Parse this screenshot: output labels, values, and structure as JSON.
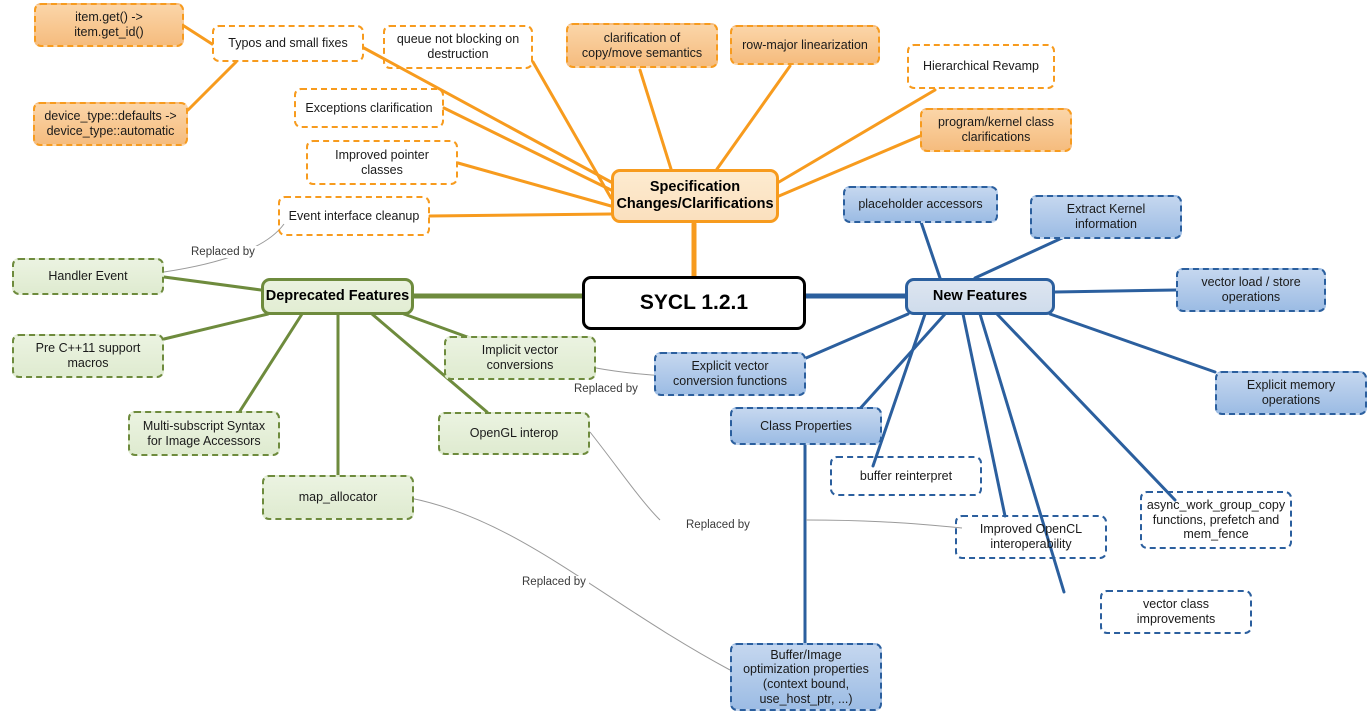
{
  "diagram": {
    "title": "SYCL 1.2.1 mind map",
    "colors": {
      "root_border": "#000000",
      "spec_branch": "#F79B1E",
      "deprecated_branch": "#6E8B3D",
      "new_features_branch": "#2B5F9E",
      "replaced_by_line": "#9a9a9a"
    },
    "root": {
      "label": "SYCL 1.2.1"
    },
    "branches": [
      {
        "id": "spec",
        "label": "Specification\nChanges/Clarifications",
        "color": "#F79B1E"
      },
      {
        "id": "deprecated",
        "label": "Deprecated Features",
        "color": "#6E8B3D"
      },
      {
        "id": "new",
        "label": "New Features",
        "color": "#2B5F9E"
      }
    ],
    "spec_nodes": [
      {
        "id": "typos",
        "label": "Typos and small fixes",
        "filled": false
      },
      {
        "id": "item_get",
        "label": "item.get() ->\nitem.get_id()",
        "filled": true
      },
      {
        "id": "device_type",
        "label": "device_type::defaults ->\ndevice_type::automatic",
        "filled": true
      },
      {
        "id": "queue_block",
        "label": "queue not blocking on\ndestruction",
        "filled": false
      },
      {
        "id": "copy_move",
        "label": "clarification of\ncopy/move semantics",
        "filled": true
      },
      {
        "id": "row_major",
        "label": "row-major linearization",
        "filled": true
      },
      {
        "id": "hierarchical",
        "label": "Hierarchical Revamp",
        "filled": false
      },
      {
        "id": "prog_kernel",
        "label": "program/kernel class\nclarifications",
        "filled": true
      },
      {
        "id": "exceptions",
        "label": "Exceptions clarification",
        "filled": false
      },
      {
        "id": "pointer",
        "label": "Improved pointer\nclasses",
        "filled": false
      },
      {
        "id": "event_iface",
        "label": "Event interface cleanup",
        "filled": false
      }
    ],
    "deprecated_nodes": [
      {
        "id": "handler_event",
        "label": "Handler Event",
        "filled": true
      },
      {
        "id": "pre_cxx11",
        "label": "Pre C++11 support\nmacros",
        "filled": true
      },
      {
        "id": "multi_sub",
        "label": "Multi-subscript Syntax\nfor Image Accessors",
        "filled": true
      },
      {
        "id": "map_allocator",
        "label": "map_allocator",
        "filled": true
      },
      {
        "id": "opengl",
        "label": "OpenGL interop",
        "filled": true
      },
      {
        "id": "implicit_vec",
        "label": "Implicit vector\nconversions",
        "filled": true
      }
    ],
    "new_nodes": [
      {
        "id": "placeholder",
        "label": "placeholder accessors",
        "filled": true
      },
      {
        "id": "extract_kernel",
        "label": "Extract Kernel\ninformation",
        "filled": true
      },
      {
        "id": "vector_ls",
        "label": "vector load / store\noperations",
        "filled": true
      },
      {
        "id": "explicit_mem",
        "label": "Explicit memory\noperations",
        "filled": true
      },
      {
        "id": "explicit_vec",
        "label": "Explicit vector\nconversion functions",
        "filled": true
      },
      {
        "id": "class_props",
        "label": "Class Properties",
        "filled": true
      },
      {
        "id": "buffer_reint",
        "label": "buffer reinterpret",
        "filled": false
      },
      {
        "id": "improved_ocl",
        "label": "Improved OpenCL\ninteroperability",
        "filled": false
      },
      {
        "id": "async_wgc",
        "label": "async_work_group_copy\nfunctions, prefetch and\nmem_fence",
        "filled": false
      },
      {
        "id": "vec_class_impr",
        "label": "vector class\nimprovements",
        "filled": false
      },
      {
        "id": "buffer_img_opt",
        "label": "Buffer/Image\noptimization properties\n(context bound,\nuse_host_ptr, ...)",
        "filled": true
      }
    ],
    "edge_labels": [
      {
        "id": "replaced_by_1",
        "label": "Replaced by"
      },
      {
        "id": "replaced_by_2",
        "label": "Replaced by"
      },
      {
        "id": "replaced_by_3",
        "label": "Replaced by"
      },
      {
        "id": "replaced_by_4",
        "label": "Replaced by"
      }
    ]
  }
}
